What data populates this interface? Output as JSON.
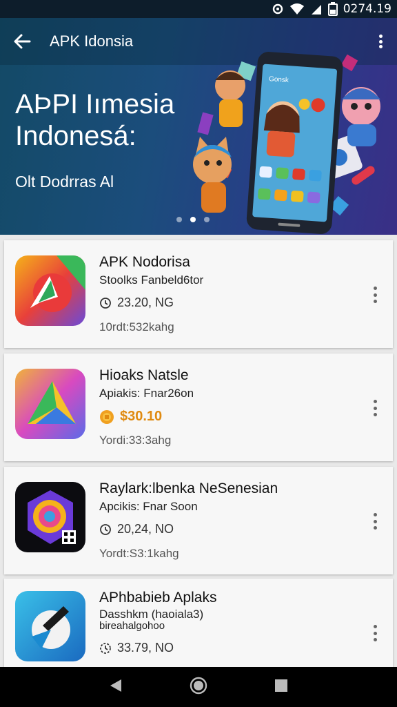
{
  "status_bar": {
    "time": "0274.19"
  },
  "app_bar": {
    "title": "APK Idonsia"
  },
  "hero": {
    "title_line1": "AÞPI Iımesia",
    "title_line2": "Indonesá:",
    "subtitle": "Olt Dodrras Al",
    "phone_label": "Gonsk",
    "pages": 3,
    "active_page": 2
  },
  "apps": [
    {
      "name": "APK Nodorisa",
      "developer": "Stoolks Fanbeld6tor",
      "price": "23.20, NG",
      "size": "10rdt:532kahg",
      "price_style": "plain"
    },
    {
      "name": "Hioaks Natsle",
      "developer": "Apiakis: Fnar26on",
      "price": "$30.10",
      "size": "Yordi:33:3ahg",
      "price_style": "orange"
    },
    {
      "name": "Raylark:lbenka NeSenesian",
      "developer": "Apcikis: Fnar Soon",
      "price": "20,24, NO",
      "size": "Yordt:S3:1kahg",
      "price_style": "plain"
    },
    {
      "name": "APhbabieb Aplaks",
      "developer": "Dasshkm (haoiala3)",
      "developer2": "bireahalgohoo",
      "price": "33.79, NO",
      "price_style": "plain"
    }
  ],
  "colors": {
    "hero_start": "#134a66",
    "hero_end": "#3a2f86",
    "price_accent": "#e08a10"
  }
}
